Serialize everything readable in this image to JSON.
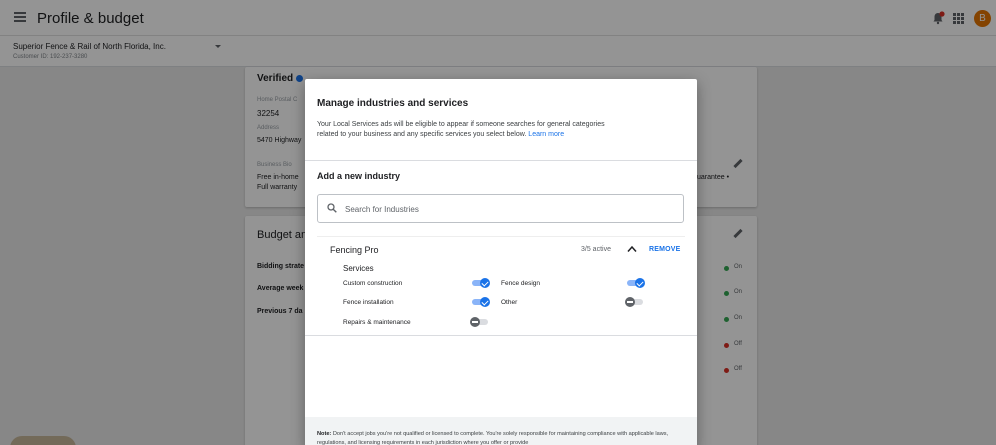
{
  "header": {
    "title": "Profile & budget",
    "avatar_letter": "B",
    "account_name": "Superior Fence & Rail of North Florida, Inc.",
    "customer_id": "Customer ID: 192-237-3280"
  },
  "background": {
    "verified_label": "Verified",
    "home_postal_label": "Home Postal C",
    "postal_code": "32254",
    "address_label": "Address",
    "address_value": "5470 Highway",
    "business_bio_label": "Business Bio",
    "bio_line1": "Free in-home",
    "bio_line2": "Full warranty",
    "guarantee_fragment": "uarantee •",
    "budget_heading": "Budget an",
    "bidding_strategy": "Bidding strate",
    "average_week": "Average week",
    "previous_7_days": "Previous 7 da",
    "statuses": [
      "On",
      "On",
      "On",
      "Off",
      "Off"
    ],
    "status_colors": {
      "on": "#34a853",
      "off": "#d93025"
    }
  },
  "modal": {
    "title": "Manage industries and services",
    "description": "Your Local Services ads will be eligible to appear if someone searches for general categories related to your business and any specific services you select below.",
    "learn_more": "Learn more",
    "add_industry_heading": "Add a new industry",
    "search_placeholder": "Search for Industries",
    "industry": {
      "name": "Fencing Pro",
      "active_count": "3/5 active",
      "remove_label": "REMOVE",
      "services_heading": "Services",
      "services": [
        {
          "label": "Custom construction",
          "enabled": true
        },
        {
          "label": "Fence design",
          "enabled": true
        },
        {
          "label": "Fence installation",
          "enabled": true
        },
        {
          "label": "Other",
          "enabled": false
        },
        {
          "label": "Repairs & maintenance",
          "enabled": false
        }
      ]
    },
    "note_bold": "Note:",
    "note_text": " Don't accept jobs you're not qualified or licensed to complete. You're solely responsible for maintaining compliance with applicable laws, regulations, and licensing requirements in each jurisdiction where you offer or provide"
  },
  "colors": {
    "accent": "#1a73e8",
    "notification": "#d93025",
    "avatar": "#e37400"
  }
}
